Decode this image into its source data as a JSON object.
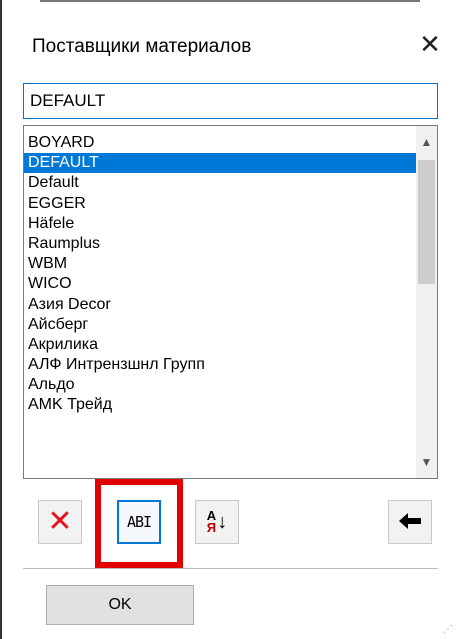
{
  "window": {
    "title": "Поставщики материалов",
    "close_icon": "✕"
  },
  "name_input": {
    "value": "DEFAULT"
  },
  "suppliers": {
    "selected_index": 1,
    "items": [
      "BOYARD",
      "DEFAULT",
      "Default",
      "EGGER",
      "Häfele",
      "Raumplus",
      "WBM",
      "WICO",
      "Азия Decor",
      "Айсберг",
      "Акрилика",
      "АЛФ Интрензшнл Групп",
      "Альдо",
      "AMK Трейд"
    ],
    "scrollbar": {
      "up_icon": "▲",
      "down_icon": "▼"
    }
  },
  "toolbar": {
    "delete_icon": "✕",
    "rename_icon": "ab-rename-icon",
    "rename_glyph": "ABI",
    "sort_icon": "sort-alpha-icon",
    "sort_letter_top": "A",
    "sort_letter_bottom": "Я",
    "sort_arrow": "↓",
    "back_icon": "🡐",
    "back_glyph": "◀"
  },
  "highlight": {
    "color": "#e00000"
  },
  "ok_label": "OK",
  "colors": {
    "accent": "#0078d7",
    "delete": "#e81123"
  }
}
